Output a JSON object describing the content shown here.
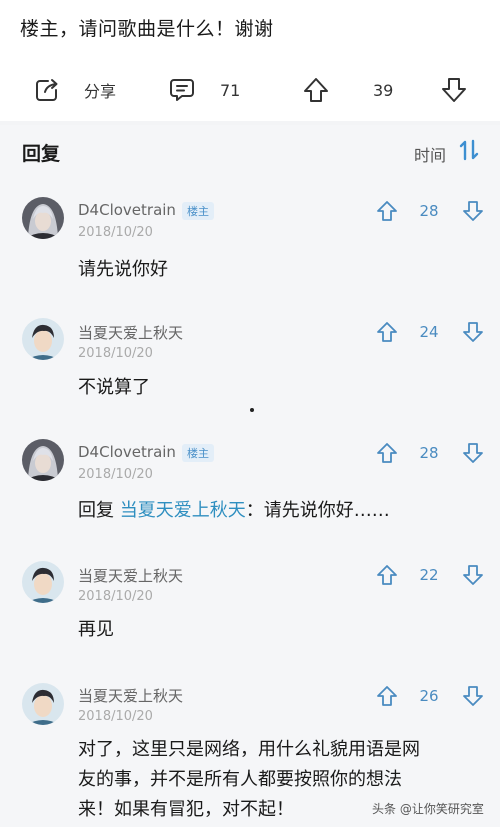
{
  "post": {
    "question": "楼主，请问歌曲是什么！谢谢"
  },
  "action_bar": {
    "share_label": "分享",
    "comment_count": "71",
    "upvote_count": "39",
    "icons": [
      "share-icon",
      "comment-icon",
      "upvote-icon",
      "downvote-icon"
    ]
  },
  "replies": {
    "heading": "回复",
    "sort_label": "时间",
    "sort_icon": "sort-icon",
    "items": [
      {
        "user": "D4Clovetrain",
        "badge": "楼主",
        "date": "2018/10/20",
        "votes": "28",
        "text": "请先说你好"
      },
      {
        "user": "当夏天爱上秋天",
        "date": "2018/10/20",
        "votes": "24",
        "text": "不说算了"
      },
      {
        "user": "D4Clovetrain",
        "badge": "楼主",
        "date": "2018/10/20",
        "votes": "28",
        "reply_prefix": "回复 ",
        "mention": "当夏天爱上秋天",
        "text": "：请先说你好……"
      },
      {
        "user": "当夏天爱上秋天",
        "date": "2018/10/20",
        "votes": "22",
        "text": "再见"
      },
      {
        "user": "当夏天爱上秋天",
        "date": "2018/10/20",
        "votes": "26",
        "text_lines": [
          "对了，这里只是网络，用什么礼貌用语是网",
          "友的事，并不是所有人都要按照你的想法",
          "来！如果有冒犯，对不起！"
        ]
      }
    ]
  },
  "colors": {
    "accent_blue": "#4a8bc0",
    "mention_blue": "#2f8fc0",
    "section_bg": "#f5f6f8"
  },
  "watermark": "头条 @让你笑研究室"
}
